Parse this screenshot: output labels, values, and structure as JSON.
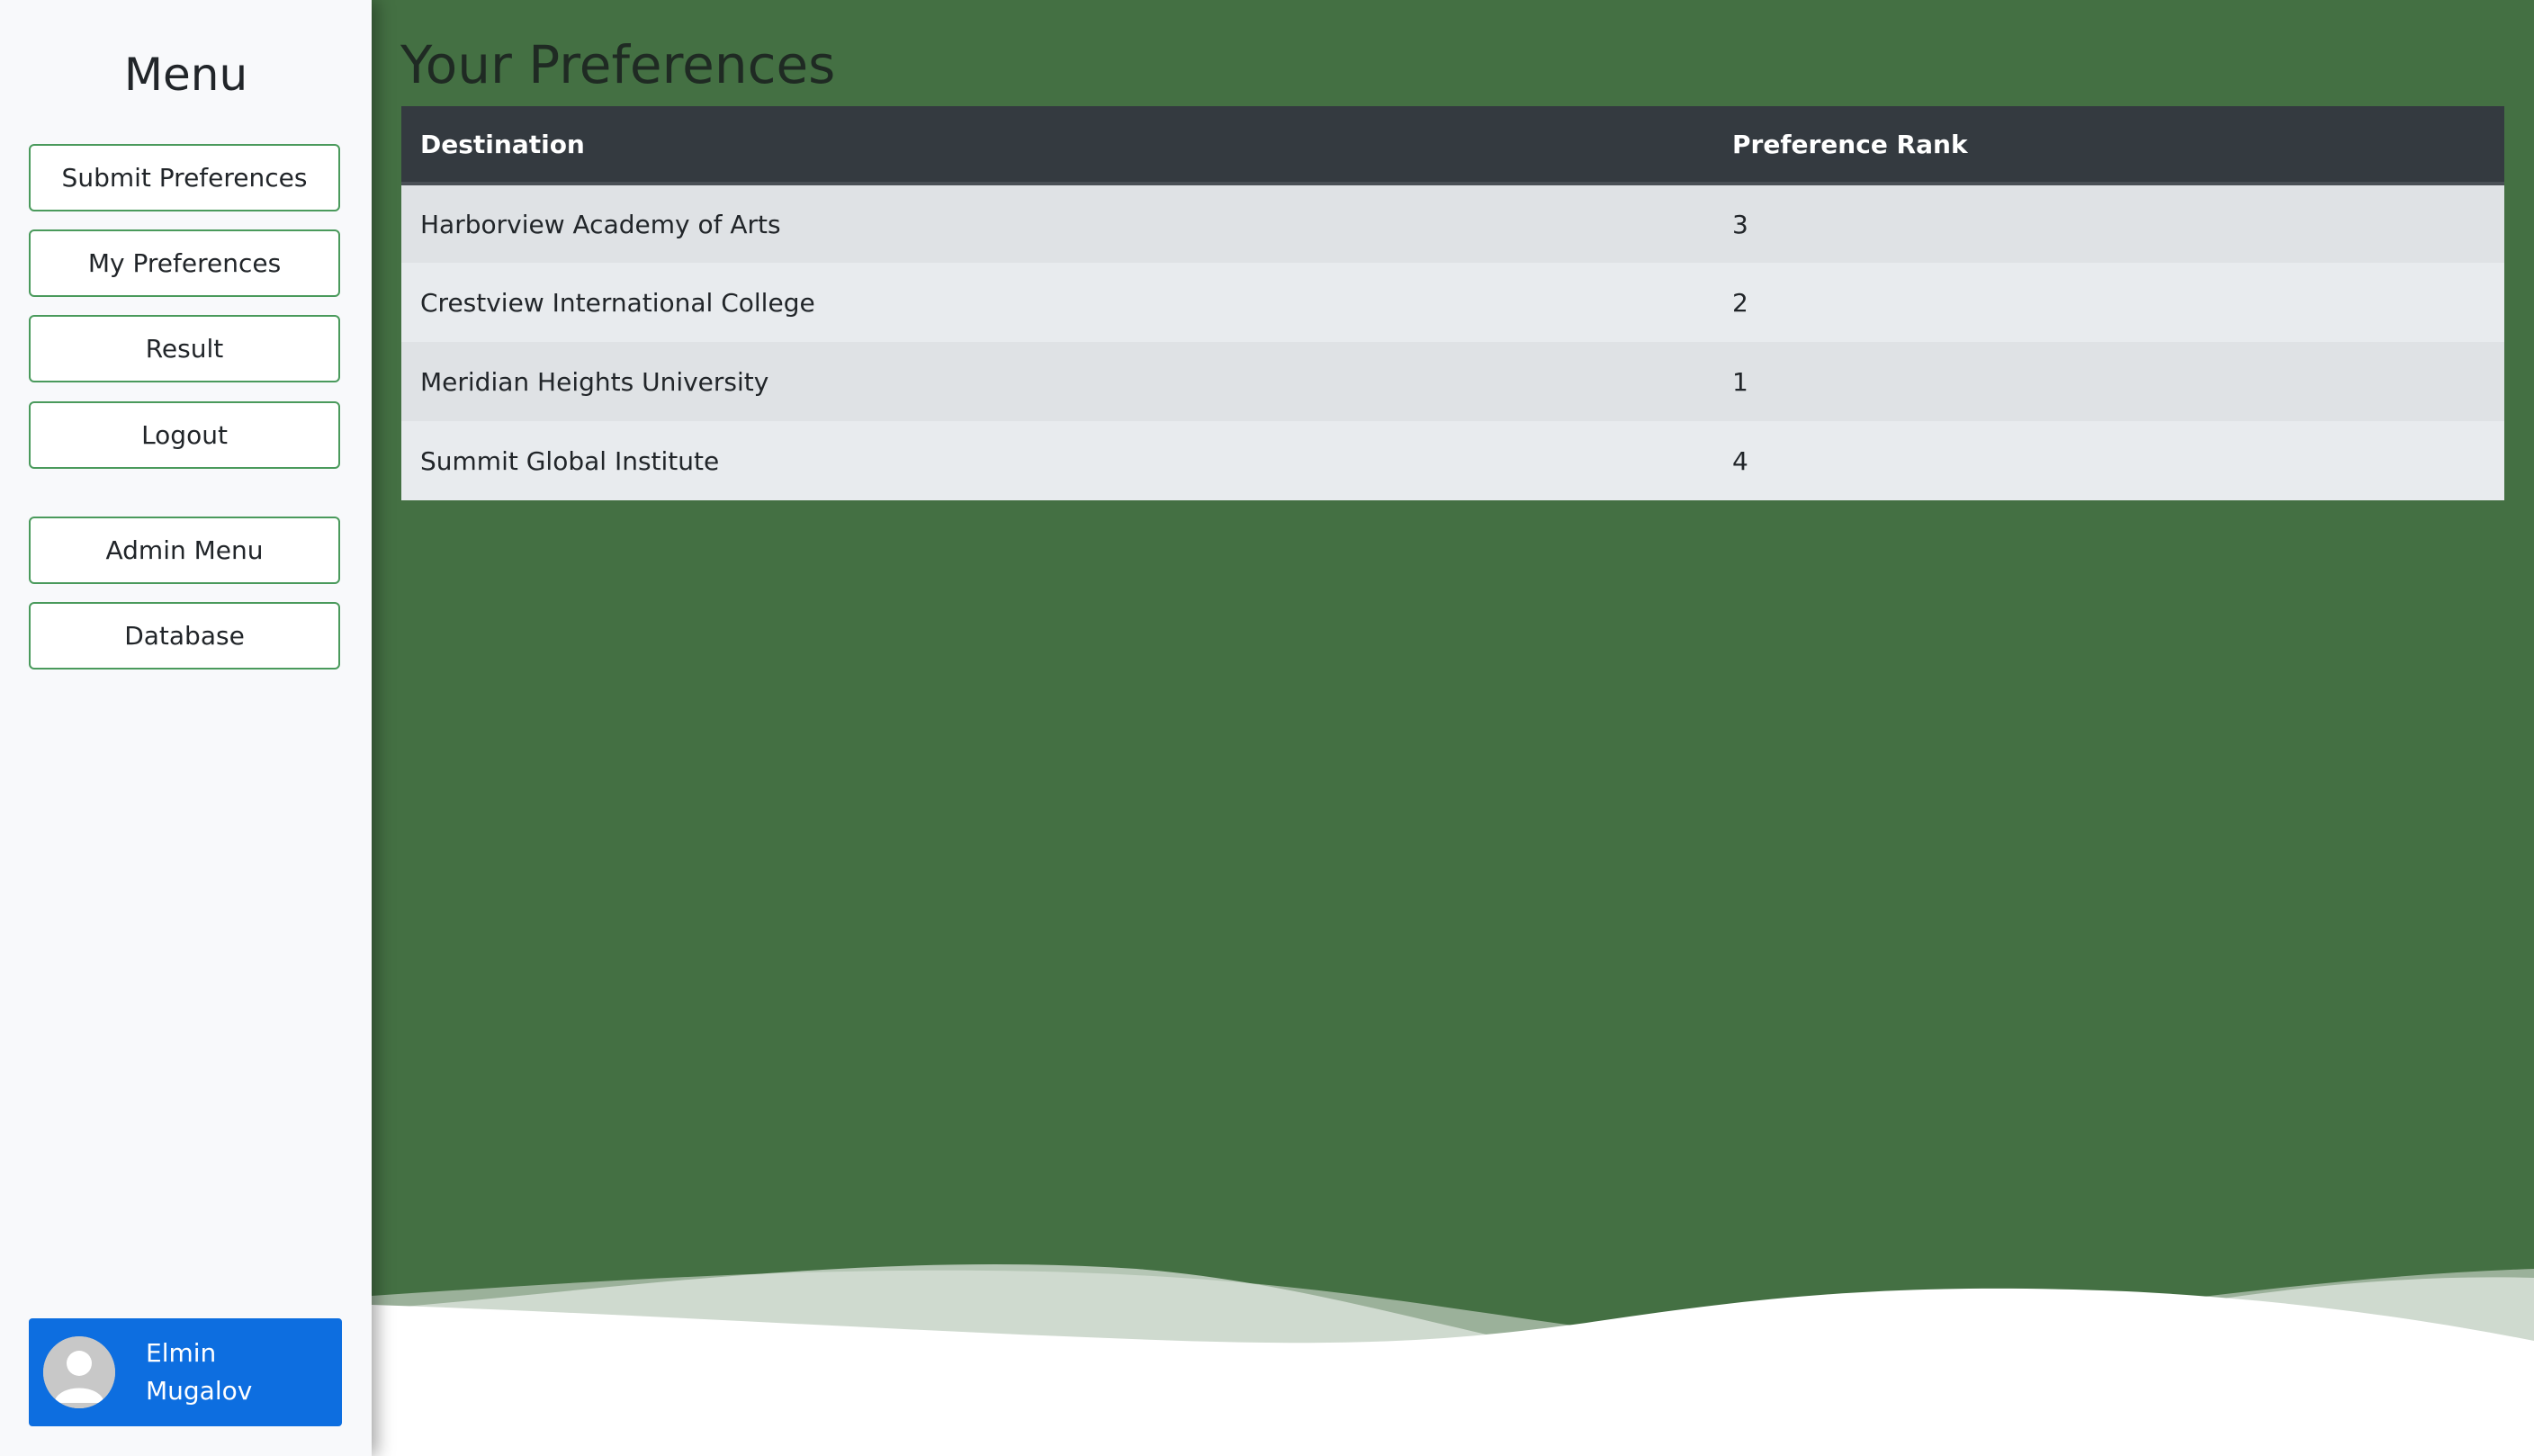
{
  "sidebar": {
    "title": "Menu",
    "buttons": [
      {
        "label": "Submit Preferences"
      },
      {
        "label": "My Preferences"
      },
      {
        "label": "Result"
      },
      {
        "label": "Logout"
      }
    ],
    "admin_buttons": [
      {
        "label": "Admin Menu"
      },
      {
        "label": "Database"
      }
    ],
    "user": {
      "first_name": "Elmin",
      "last_name": "Mugalov",
      "avatar_icon": "user-avatar-icon"
    }
  },
  "main": {
    "title": "Your Preferences",
    "table": {
      "headers": [
        "Destination",
        "Preference Rank"
      ],
      "rows": [
        [
          "Harborview Academy of Arts",
          "3"
        ],
        [
          "Crestview International College",
          "2"
        ],
        [
          "Meridian Heights University",
          "1"
        ],
        [
          "Summit Global Institute",
          "4"
        ]
      ]
    }
  },
  "colors": {
    "background": "#447043",
    "sidebar": "#f8f9fb",
    "button_border": "#4a9a5c",
    "user_card": "#0d6ee0",
    "table_header": "#343a40"
  }
}
